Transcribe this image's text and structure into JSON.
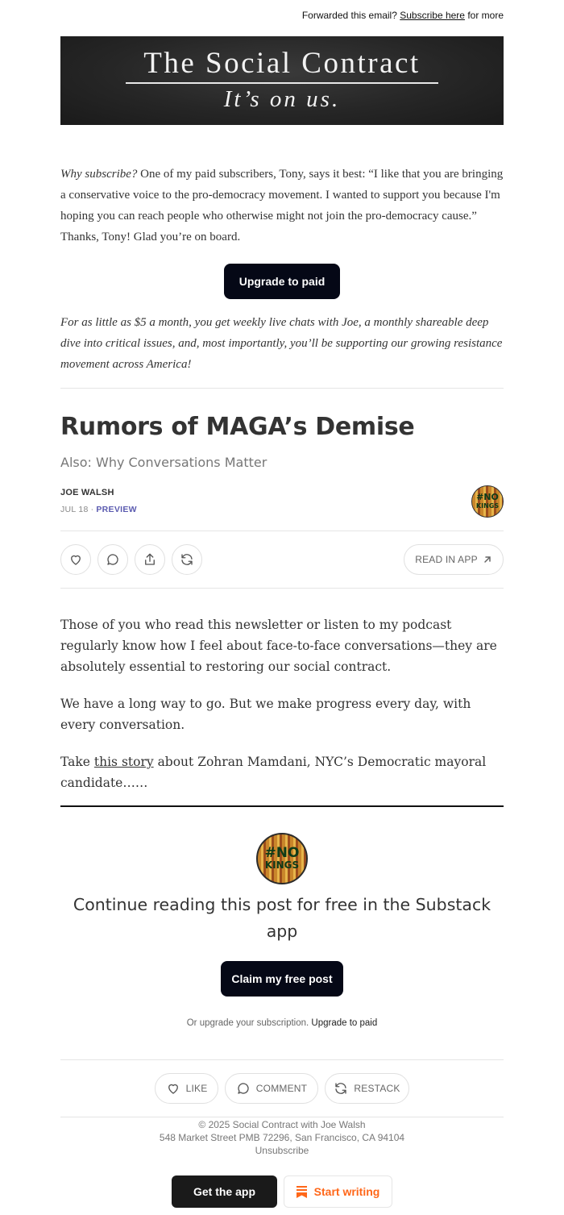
{
  "top_bar": {
    "prefix": "Forwarded this email?",
    "link": "Subscribe here",
    "suffix": "for more"
  },
  "banner": {
    "title": "The Social Contract",
    "tagline": "It’s on us."
  },
  "promo": {
    "lead": "Why subscribe?",
    "text": "One of my paid subscribers, Tony, says it best: “I like that you are bringing a conservative voice to the pro-democracy movement. I wanted to support you because I'm hoping you can reach people who otherwise might not join the pro-democracy cause.” Thanks, Tony! Glad you’re on board.",
    "button": "Upgrade to paid",
    "pitch": "For as little as $5 a month, you get weekly live chats with Joe, a monthly shareable deep dive into critical issues, and, most importantly, you’ll be supporting our growing resistance movement across America!"
  },
  "post": {
    "title": "Rumors of MAGA’s Demise",
    "subtitle": "Also: Why Conversations Matter",
    "author": "JOE WALSH",
    "date": "JUL 18",
    "separator": "∙",
    "preview_label": "PREVIEW",
    "avatar_text_1": "#NO",
    "avatar_text_2": "KINGS",
    "read_in_app": "READ IN APP"
  },
  "body": {
    "p1": "Those of you who read this newsletter or listen to my podcast regularly know how I feel about face-to-face conversations—they are absolutely essential to restoring our social contract.",
    "p2": "We have a long way to go. But we make progress every day, with every conversation.",
    "p3_start": "Take",
    "p3_link": "this story",
    "p3_end": "about Zohran Mamdani, NYC’s Democratic mayoral candidate……"
  },
  "continue_block": {
    "heading": "Continue reading this post for free in the Substack app",
    "button": "Claim my free post",
    "or_text": "Or upgrade your subscription.",
    "upgrade_link": "Upgrade to paid"
  },
  "actions": {
    "like": "LIKE",
    "comment": "COMMENT",
    "restack": "RESTACK"
  },
  "footer": {
    "copyright": "© 2025 Social Contract with Joe Walsh",
    "address": "548 Market Street PMB 72296, San Francisco, CA 94104",
    "unsubscribe": "Unsubscribe"
  },
  "cta": {
    "get_app": "Get the app",
    "start_writing": "Start writing"
  },
  "colors": {
    "primary_button": "#050816",
    "accent_orange": "#ff6719",
    "preview_link": "#5b5bb0"
  }
}
